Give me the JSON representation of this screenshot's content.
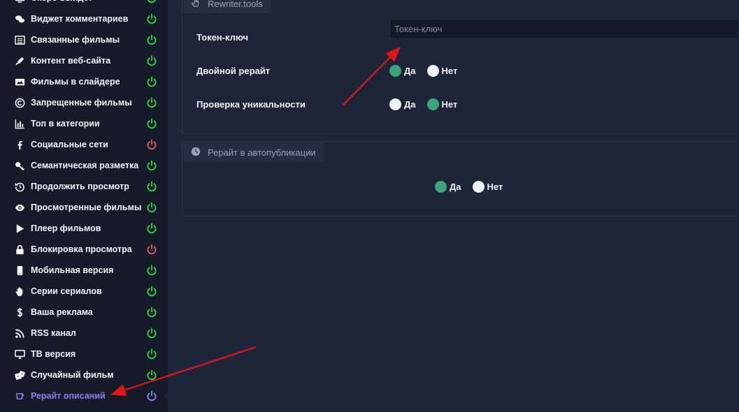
{
  "colors": {
    "power_on": "#2ecc40",
    "power_off": "#e0506a",
    "power_active": "#8b7ff0",
    "radio_on": "#3aa57a",
    "arrow": "#e01515"
  },
  "sidebar": {
    "items": [
      {
        "label": "Скоро выйдет",
        "icon": "tv-icon",
        "status": "on"
      },
      {
        "label": "Виджет комментариев",
        "icon": "comments-icon",
        "status": "on"
      },
      {
        "label": "Связанные фильмы",
        "icon": "list-icon",
        "status": "on"
      },
      {
        "label": "Контент веб-сайта",
        "icon": "pen-icon",
        "status": "on"
      },
      {
        "label": "Фильмы в слайдере",
        "icon": "images-icon",
        "status": "on"
      },
      {
        "label": "Запрещенные фильмы",
        "icon": "copyright-icon",
        "status": "on"
      },
      {
        "label": "Топ в категории",
        "icon": "chart-icon",
        "status": "on"
      },
      {
        "label": "Социальные сети",
        "icon": "facebook-icon",
        "status": "off"
      },
      {
        "label": "Семантическая разметка",
        "icon": "key-icon",
        "status": "on"
      },
      {
        "label": "Продолжить просмотр",
        "icon": "history-icon",
        "status": "on"
      },
      {
        "label": "Просмотренные фильмы",
        "icon": "eye-icon",
        "status": "on"
      },
      {
        "label": "Плеер фильмов",
        "icon": "play-icon",
        "status": "on"
      },
      {
        "label": "Блокировка просмотра",
        "icon": "lock-icon",
        "status": "off"
      },
      {
        "label": "Мобильная версия",
        "icon": "mobile-icon",
        "status": "on"
      },
      {
        "label": "Серии сериалов",
        "icon": "hand-icon",
        "status": "on"
      },
      {
        "label": "Ваша реклама",
        "icon": "dollar-icon",
        "status": "on"
      },
      {
        "label": "RSS канал",
        "icon": "rss-icon",
        "status": "on"
      },
      {
        "label": "ТВ версия",
        "icon": "desktop-icon",
        "status": "on"
      },
      {
        "label": "Случайный фильм",
        "icon": "dice-icon",
        "status": "on"
      },
      {
        "label": "Рерайт описаний",
        "icon": "rewrite-icon",
        "status": "active"
      }
    ]
  },
  "rewriter_panel": {
    "tab_label": "Rewriter.tools",
    "token_label": "Токен-ключ",
    "token_placeholder": "Токен-ключ",
    "token_value": "",
    "double_rewrite_label": "Двойной рерайт",
    "uniqueness_label": "Проверка уникальности",
    "double_rewrite": {
      "yes": "Да",
      "no": "Нет",
      "selected": "yes"
    },
    "uniqueness": {
      "yes": "Да",
      "no": "Нет",
      "selected": "no"
    }
  },
  "autopublish_panel": {
    "tab_label": "Рерайт в автопубликации",
    "toggle": {
      "yes": "Да",
      "no": "Нет",
      "selected": "yes"
    }
  }
}
